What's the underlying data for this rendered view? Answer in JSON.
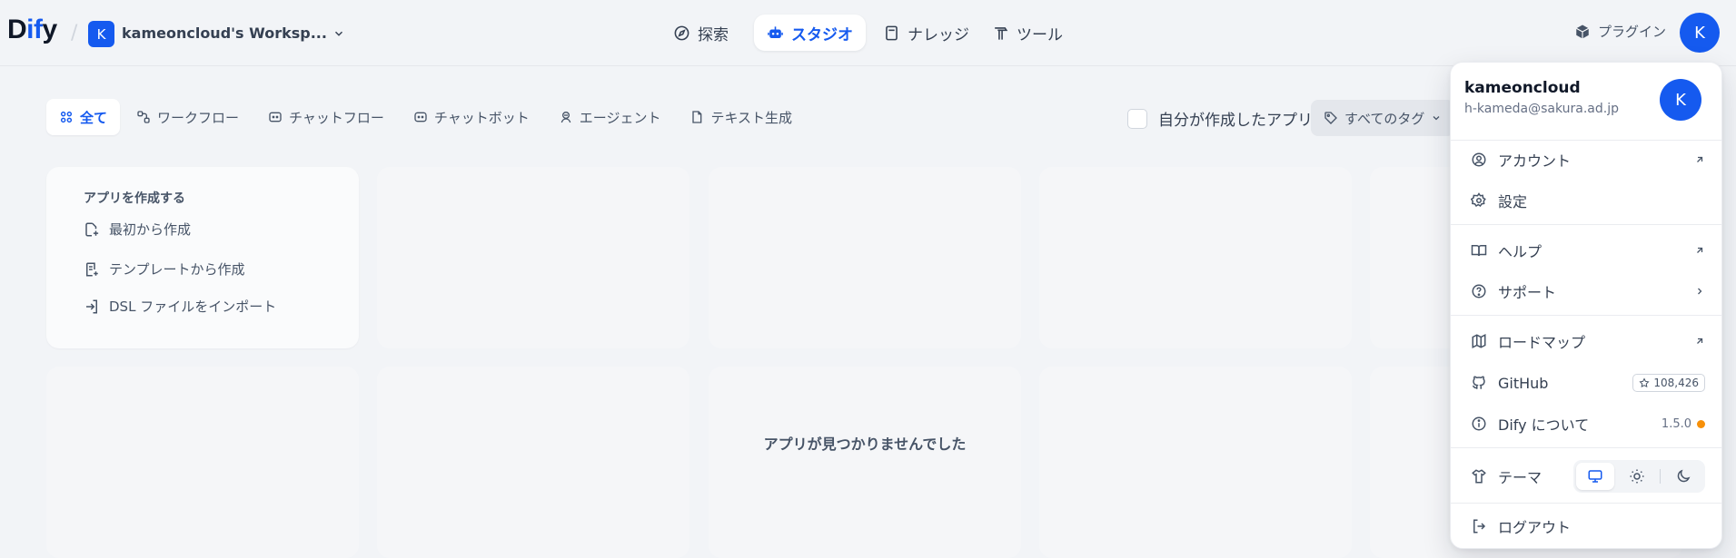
{
  "header": {
    "logo_prefix": "D",
    "logo_accent": "if",
    "logo_suffix": "y",
    "workspace_initial": "K",
    "workspace_name": "kameoncloud's Worksp...",
    "nav": [
      {
        "label": "探索",
        "icon": "compass-icon"
      },
      {
        "label": "スタジオ",
        "icon": "robot-icon"
      },
      {
        "label": "ナレッジ",
        "icon": "book-icon"
      },
      {
        "label": "ツール",
        "icon": "hammer-icon"
      }
    ],
    "plugin_label": "プラグイン",
    "avatar_initial": "K"
  },
  "filters": {
    "tabs": [
      "全て",
      "ワークフロー",
      "チャットフロー",
      "チャットボット",
      "エージェント",
      "テキスト生成"
    ],
    "mine_label": "自分が作成したアプリ",
    "tags_label": "すべてのタグ"
  },
  "create_card": {
    "title": "アプリを作成する",
    "items": [
      "最初から作成",
      "テンプレートから作成",
      "DSL ファイルをインポート"
    ]
  },
  "empty_message": "アプリが見つかりませんでした",
  "user_menu": {
    "name": "kameoncloud",
    "email": "h-kameda@sakura.ad.jp",
    "avatar_initial": "K",
    "items": {
      "account": "アカウント",
      "settings": "設定",
      "help": "ヘルプ",
      "support": "サポート",
      "roadmap": "ロードマップ",
      "github": "GitHub",
      "github_stars": "108,426",
      "about": "Dify について",
      "version": "1.5.0",
      "theme": "テーマ",
      "logout": "ログアウト"
    }
  },
  "colors": {
    "accent": "#155aef",
    "background": "#f2f4f7",
    "version_dot": "#f79009"
  }
}
